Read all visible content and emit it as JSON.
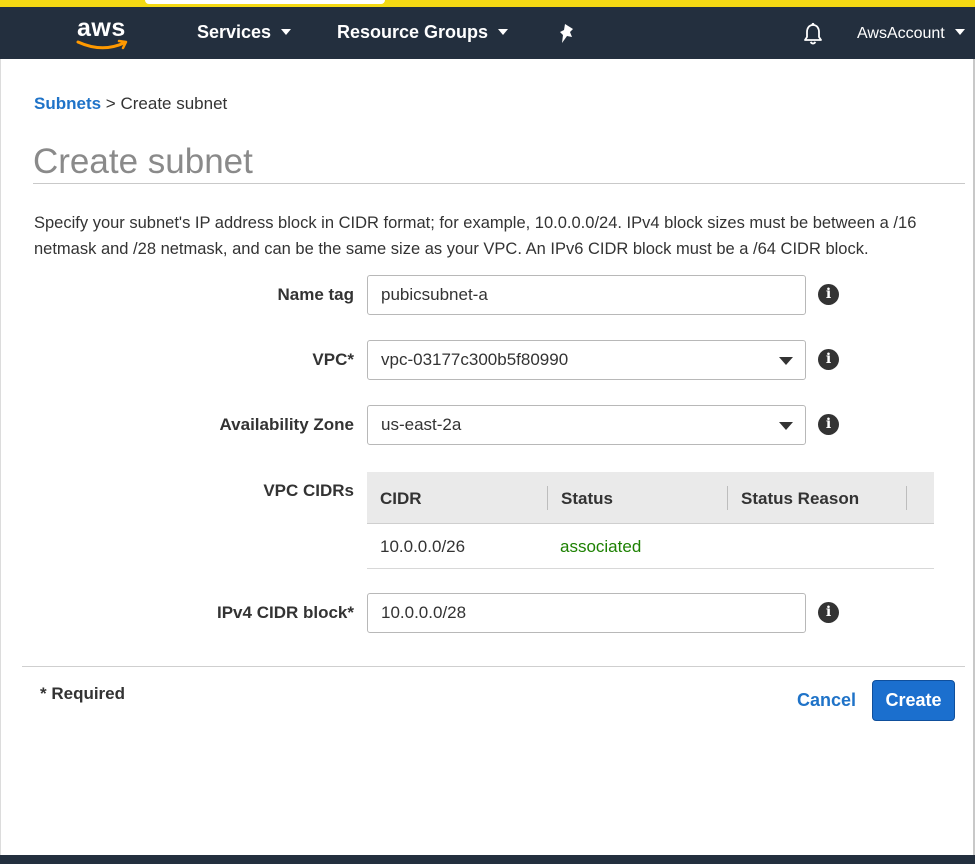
{
  "nav": {
    "logo_text": "aws",
    "services_label": "Services",
    "resource_groups_label": "Resource Groups",
    "pin_icon": "pin-icon",
    "bell_icon": "bell-icon",
    "account_label": "AwsAccount"
  },
  "breadcrumb": {
    "parent": "Subnets",
    "separator": ">",
    "current": "Create subnet"
  },
  "page_title": "Create subnet",
  "description": "Specify your subnet's IP address block in CIDR format; for example, 10.0.0.0/24. IPv4 block sizes must be between a /16 netmask and /28 netmask, and can be the same size as your VPC. An IPv6 CIDR block must be a /64 CIDR block.",
  "form": {
    "name_tag": {
      "label": "Name tag",
      "value": "pubicsubnet-a"
    },
    "vpc": {
      "label": "VPC*",
      "value": "vpc-03177c300b5f80990"
    },
    "availability_zone": {
      "label": "Availability Zone",
      "value": "us-east-2a"
    },
    "vpc_cidrs": {
      "label": "VPC CIDRs",
      "columns": [
        "CIDR",
        "Status",
        "Status Reason"
      ],
      "rows": [
        {
          "cidr": "10.0.0.0/26",
          "status": "associated",
          "status_reason": ""
        }
      ]
    },
    "ipv4_cidr": {
      "label": "IPv4 CIDR block*",
      "value": "10.0.0.0/28"
    },
    "info_icon": "info-icon",
    "info_glyph": "i"
  },
  "footer": {
    "required_note": "* Required",
    "cancel_label": "Cancel",
    "create_label": "Create"
  },
  "colors": {
    "nav_bg": "#232f3e",
    "link": "#1f73c8",
    "primary_button": "#1b6fce",
    "status_ok": "#1d8102",
    "aws_smile": "#ff9900"
  }
}
